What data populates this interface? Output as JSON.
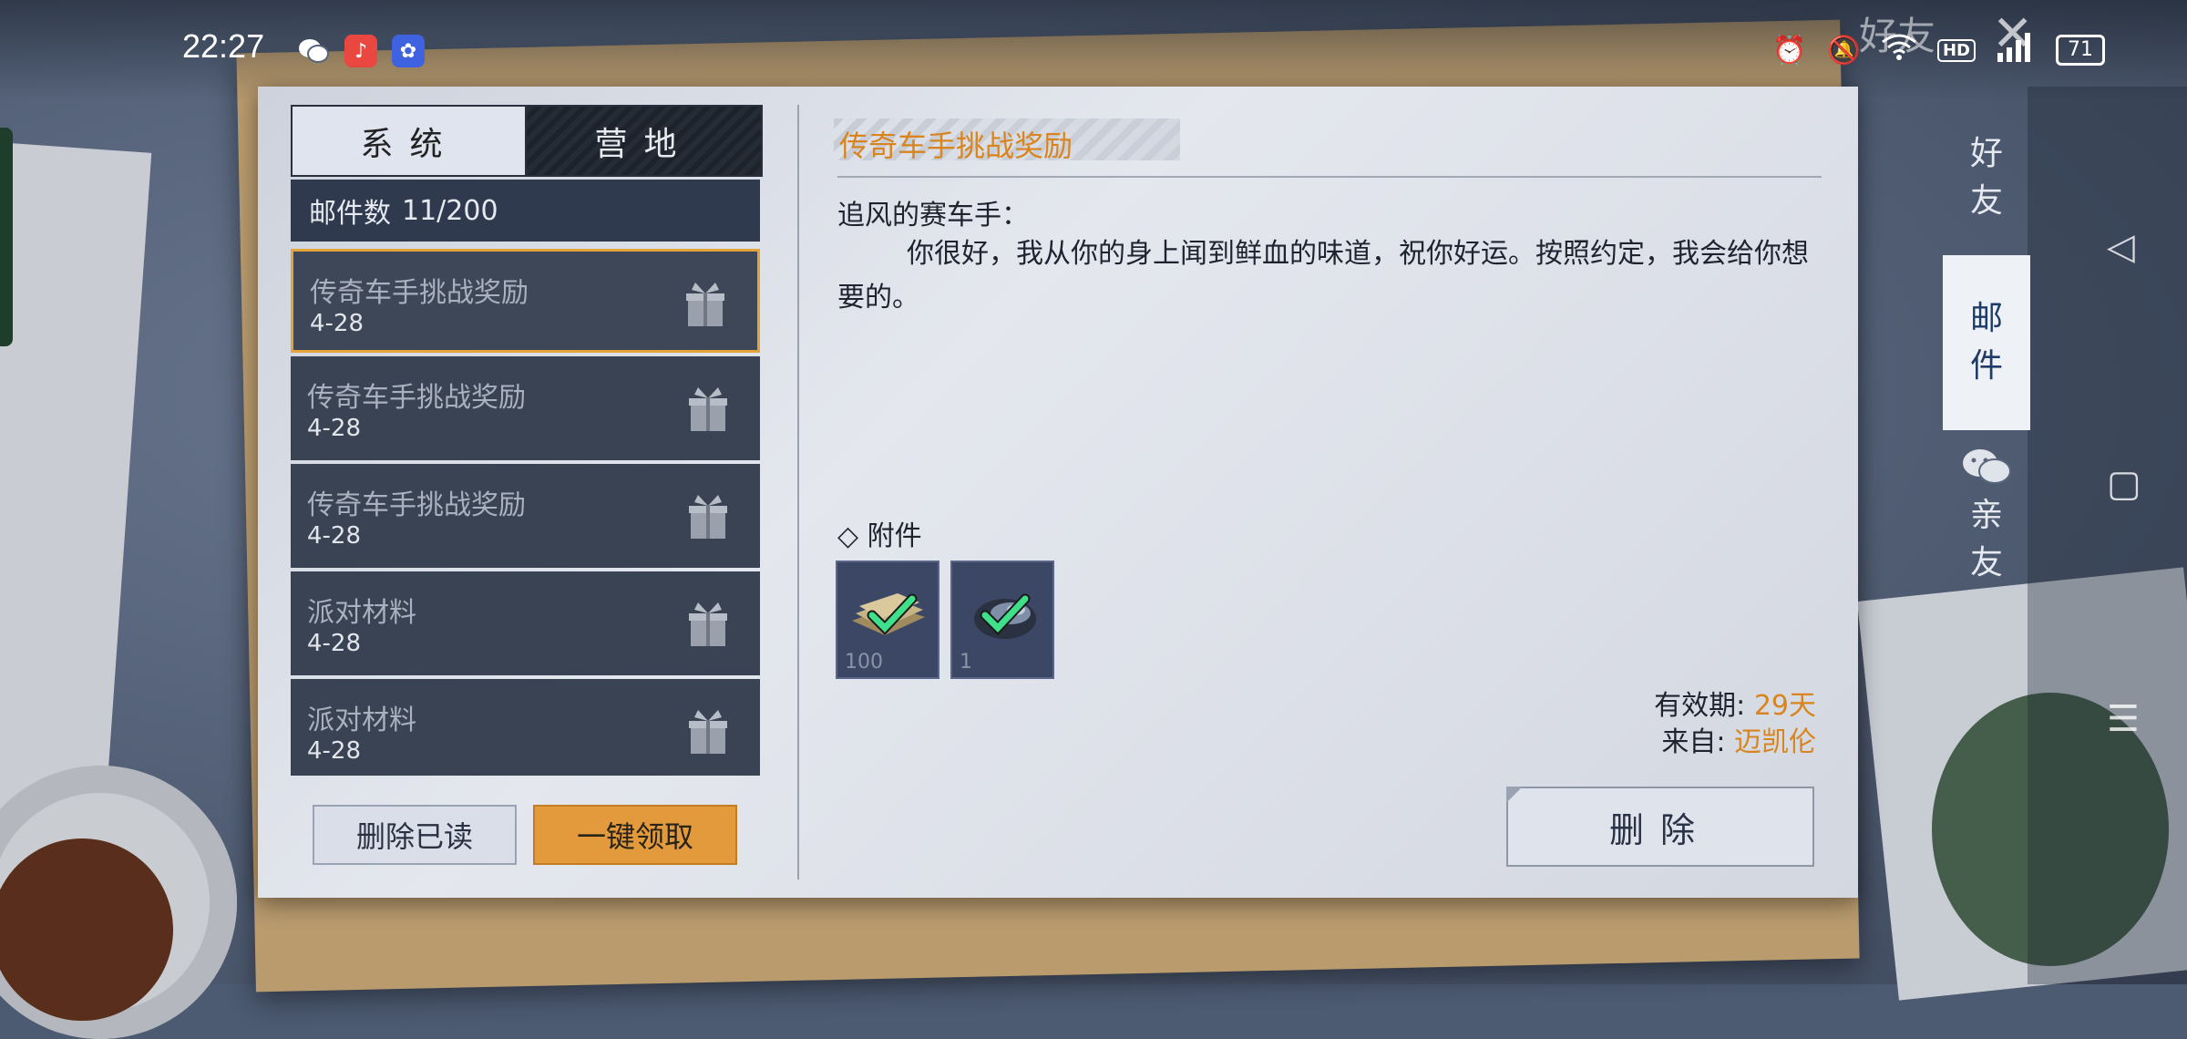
{
  "status_bar": {
    "time": "22:27",
    "overlay_text": "好友",
    "battery": "71",
    "network": "5G",
    "hd": "HD",
    "apps": [
      "wechat-icon",
      "douyin-icon",
      "baidu-icon"
    ]
  },
  "tabs": {
    "system": "系统",
    "camp": "营地"
  },
  "mail_count": {
    "label": "邮件数",
    "value": "11/200"
  },
  "mail_list": [
    {
      "title": "传奇车手挑战奖励",
      "date": "4-28",
      "selected": true
    },
    {
      "title": "传奇车手挑战奖励",
      "date": "4-28",
      "selected": false
    },
    {
      "title": "传奇车手挑战奖励",
      "date": "4-28",
      "selected": false
    },
    {
      "title": "派对材料",
      "date": "4-28",
      "selected": false
    },
    {
      "title": "派对材料",
      "date": "4-28",
      "selected": false
    }
  ],
  "buttons": {
    "delete_read": "删除已读",
    "claim_all": "一键领取",
    "delete": "删除"
  },
  "detail": {
    "title": "传奇车手挑战奖励",
    "salutation": "追风的赛车手：",
    "body": "你很好，我从你的身上闻到鲜血的味道，祝你好运。按照约定，我会给你想要的。",
    "attachments_label": "◇ 附件",
    "attachments": [
      {
        "icon": "money-stack-icon",
        "count": "100",
        "claimed": true
      },
      {
        "icon": "vehicle-part-icon",
        "count": "1",
        "claimed": true
      }
    ],
    "validity_label": "有效期:",
    "validity_value": "29天",
    "from_label": "来自:",
    "from_value": "迈凯伦"
  },
  "side_tabs": {
    "friends": [
      "好",
      "友"
    ],
    "mail": [
      "邮",
      "件"
    ],
    "family": [
      "亲",
      "友"
    ]
  },
  "colors": {
    "accent_orange": "#d8851f",
    "selected_border": "#e3a53a",
    "list_bg": "#3a4354",
    "side_active_text": "#1f3c67"
  }
}
